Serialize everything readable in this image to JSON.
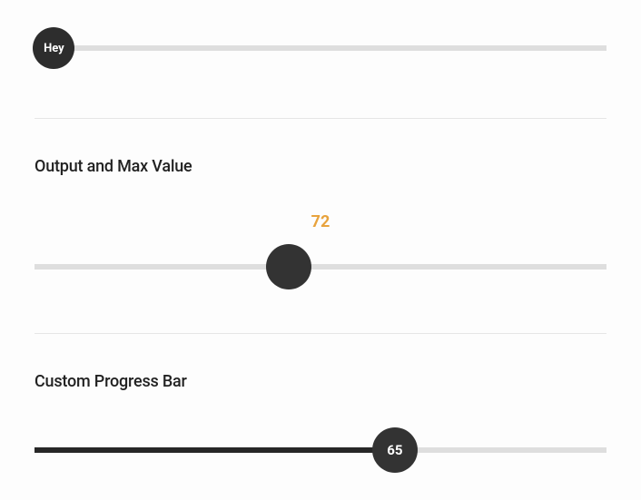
{
  "slider1": {
    "thumb_label": "Hey",
    "percent": 3.4
  },
  "section2": {
    "heading": "Output and Max Value",
    "output_value": "72",
    "percent": 44.5
  },
  "section3": {
    "heading": "Custom Progress Bar",
    "thumb_label": "65",
    "percent": 63.0
  }
}
